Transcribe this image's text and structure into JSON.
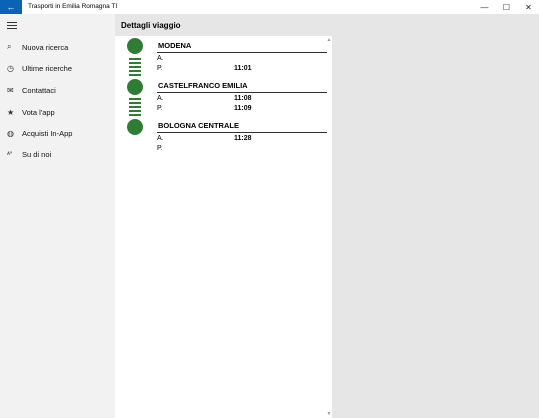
{
  "window": {
    "title": "Trasporti in Emilia Romagna TI",
    "back_glyph": "←",
    "minimize_glyph": "—",
    "maximize_glyph": "☐",
    "close_glyph": "✕"
  },
  "sidebar": {
    "items": [
      {
        "icon": "search-icon",
        "glyph": "⌕",
        "label": "Nuova ricerca"
      },
      {
        "icon": "history-icon",
        "glyph": "◷",
        "label": "Ultime ricerche"
      },
      {
        "icon": "mail-icon",
        "glyph": "✉",
        "label": "Contattaci"
      },
      {
        "icon": "star-icon",
        "glyph": "★",
        "label": "Vota l'app"
      },
      {
        "icon": "globe-icon",
        "glyph": "◍",
        "label": "Acquisti In-App"
      },
      {
        "icon": "people-icon",
        "glyph": "ᴀᵸ",
        "label": "Su di noi"
      }
    ]
  },
  "main": {
    "title": "Dettagli viaggio",
    "stops": [
      {
        "name": "MODENA",
        "arrival_label": "A.",
        "arrival": "",
        "departure_label": "P.",
        "departure": "11:01"
      },
      {
        "name": "CASTELFRANCO EMILIA",
        "arrival_label": "A.",
        "arrival": "11:08",
        "departure_label": "P.",
        "departure": "11:09"
      },
      {
        "name": "BOLOGNA CENTRALE",
        "arrival_label": "A.",
        "arrival": "11:28",
        "departure_label": "P.",
        "departure": ""
      }
    ]
  },
  "colors": {
    "accent": "#0b63b8",
    "route_green": "#2e7d32"
  }
}
